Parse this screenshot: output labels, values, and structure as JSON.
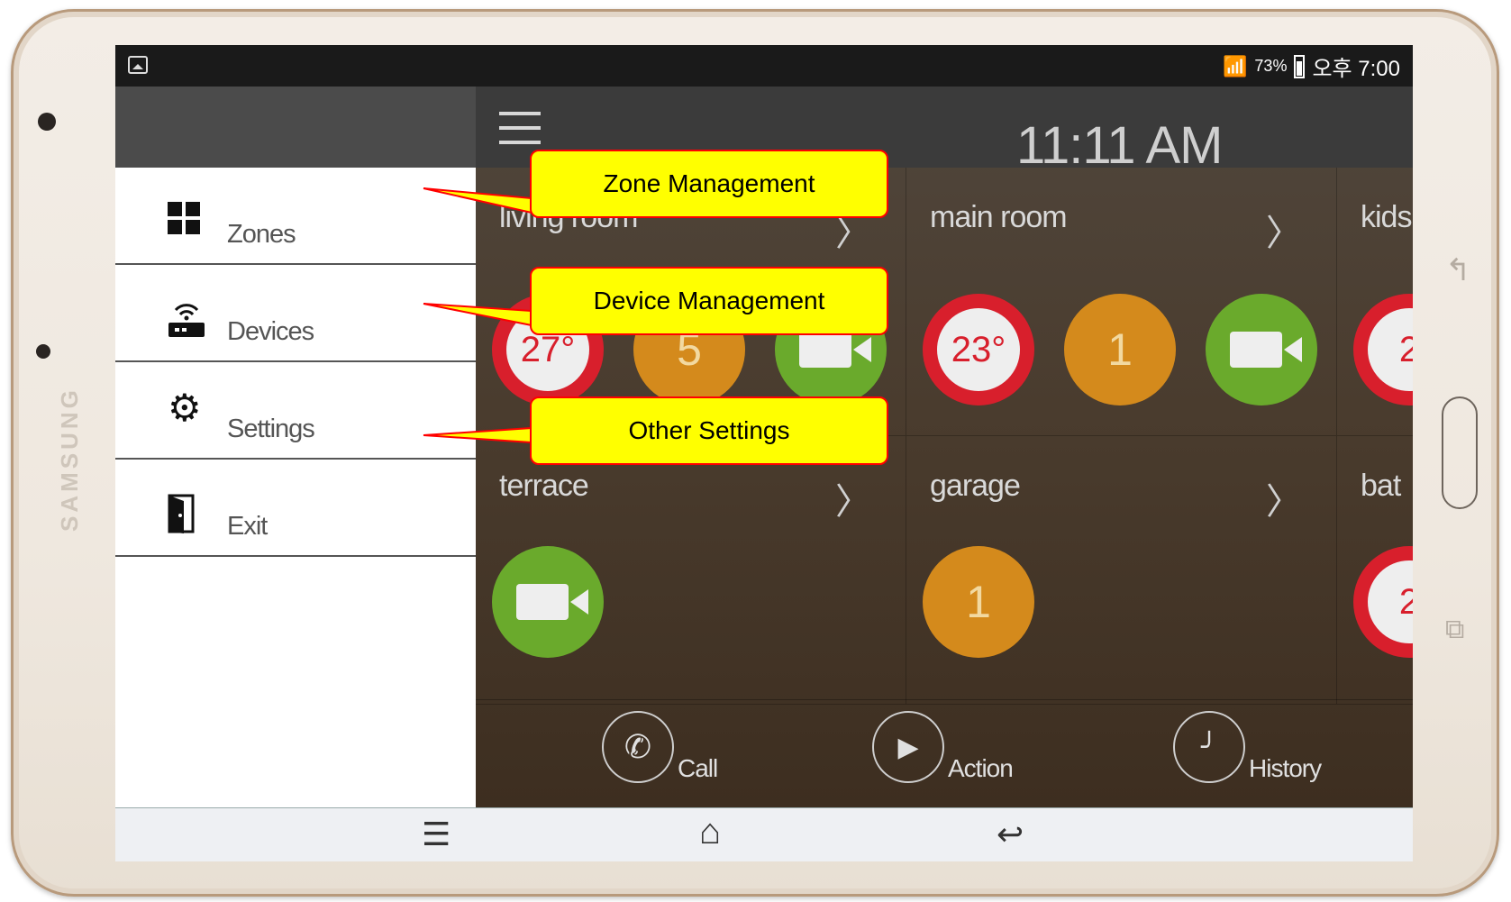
{
  "device": {
    "brand": "SAMSUNG"
  },
  "statusbar": {
    "battery": "73%",
    "time": "오후 7:00",
    "wifi_icon": "wifi-lock-icon",
    "battery_icon": "battery-icon"
  },
  "topbar": {
    "clock": "11:11 AM",
    "menu_icon": "hamburger-icon"
  },
  "drawer": {
    "items": [
      {
        "label": "Zones",
        "icon": "grid-icon"
      },
      {
        "label": "Devices",
        "icon": "router-icon"
      },
      {
        "label": "Settings",
        "icon": "gear-icon"
      },
      {
        "label": "Exit",
        "icon": "door-icon"
      }
    ]
  },
  "zones": [
    {
      "name": "living room",
      "devices": [
        {
          "type": "temperature",
          "value": "27°"
        },
        {
          "type": "light",
          "value": "5"
        },
        {
          "type": "camera",
          "value": ""
        }
      ]
    },
    {
      "name": "main room",
      "devices": [
        {
          "type": "temperature",
          "value": "23°"
        },
        {
          "type": "light",
          "value": "1"
        },
        {
          "type": "camera",
          "value": ""
        }
      ]
    },
    {
      "name": "kids",
      "devices": [
        {
          "type": "temperature",
          "value": "2"
        }
      ]
    },
    {
      "name": "terrace",
      "devices": [
        {
          "type": "camera",
          "value": ""
        }
      ]
    },
    {
      "name": "garage",
      "devices": [
        {
          "type": "light",
          "value": "1"
        }
      ]
    },
    {
      "name": "bat",
      "devices": [
        {
          "type": "temperature",
          "value": "2"
        }
      ]
    }
  ],
  "bottombar": {
    "call": "Call",
    "action": "Action",
    "history": "History"
  },
  "callouts": {
    "zone": "Zone Management",
    "device": "Device Management",
    "settings": "Other Settings"
  },
  "colors": {
    "temperature": "#d81f2c",
    "light": "#d48a1c",
    "camera": "#6aaa2c",
    "callout_fill": "#ffff00",
    "callout_border": "#ff0000"
  }
}
